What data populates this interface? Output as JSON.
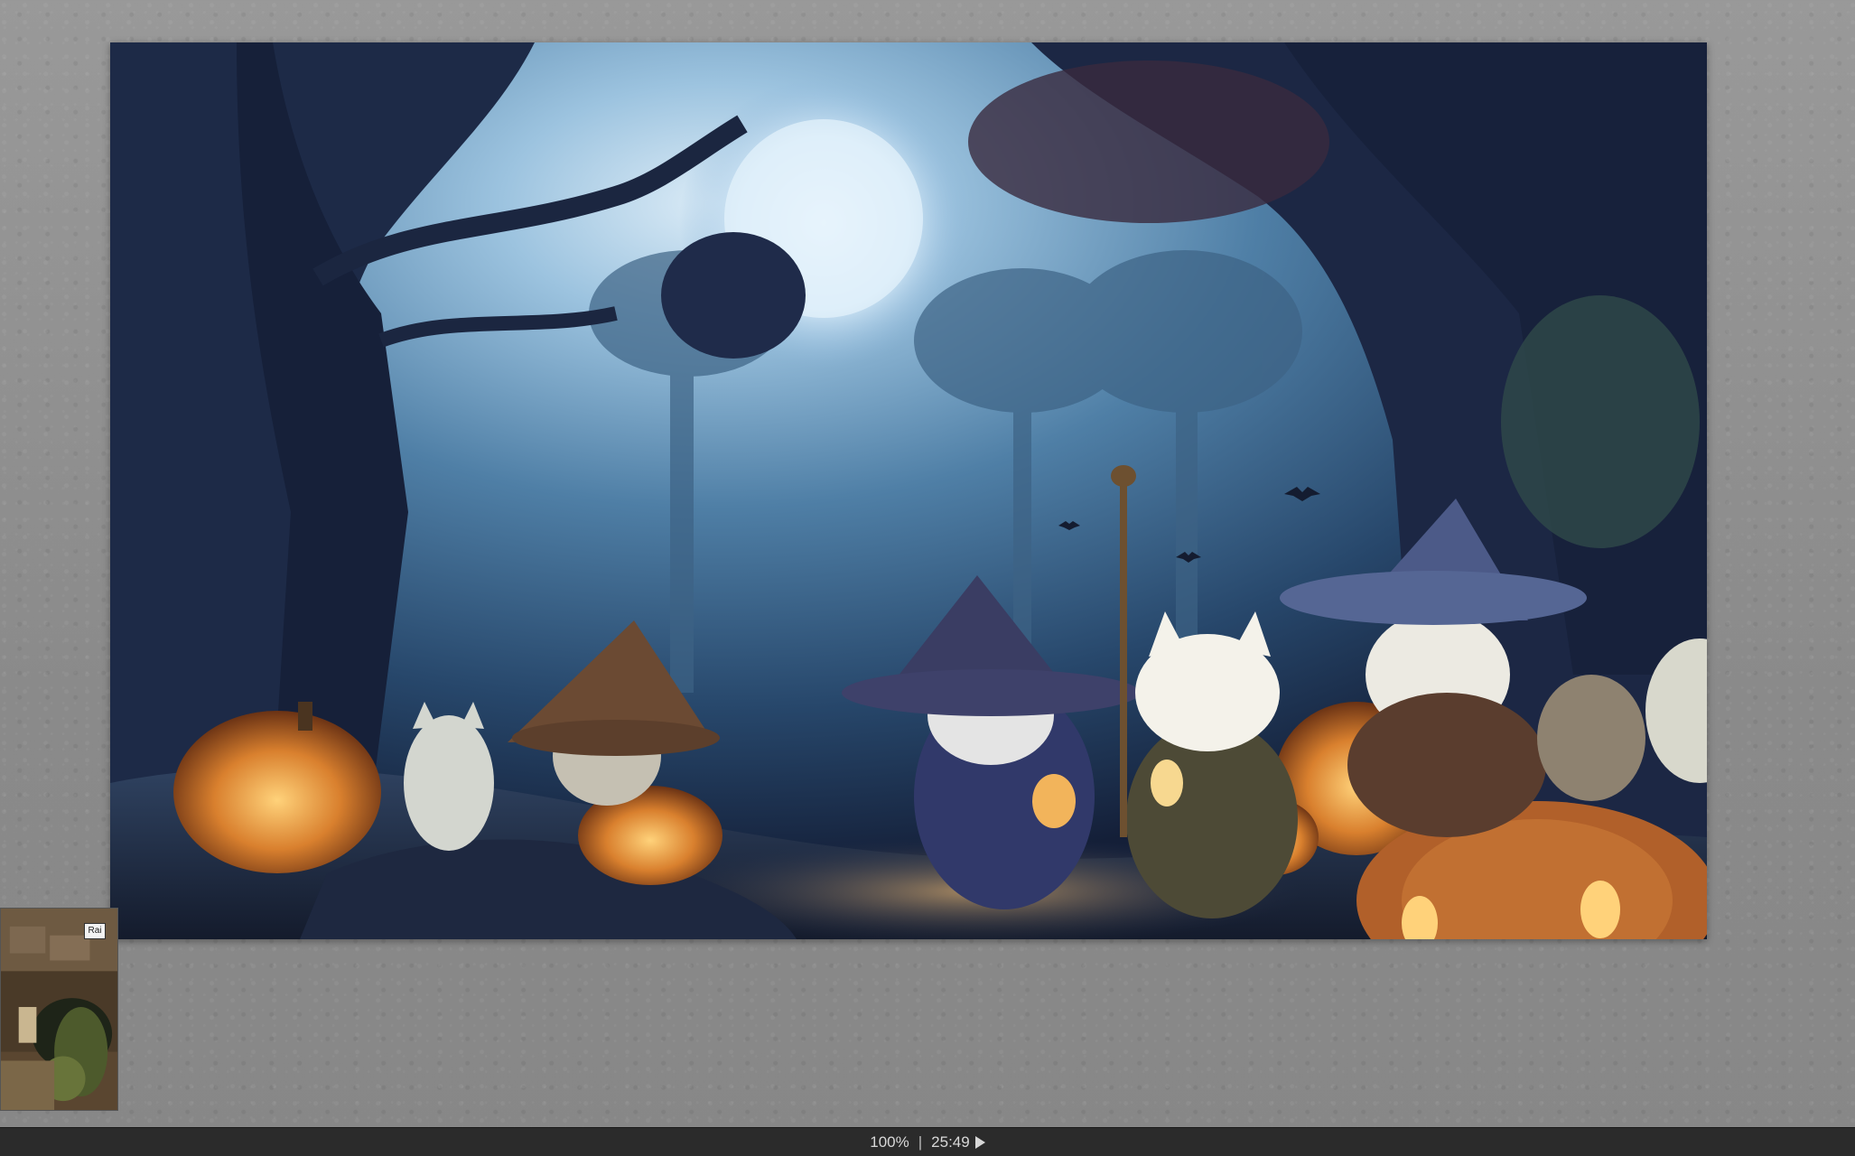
{
  "status_bar": {
    "zoom": "100%",
    "separator": "|",
    "time": "25:49",
    "play_icon": "play-icon"
  },
  "thumbnail": {
    "badge_label": "Rai"
  },
  "colors": {
    "background": "#8e8e8e",
    "status_bar": "#2b2b2b",
    "status_text": "#d8d8d8"
  }
}
